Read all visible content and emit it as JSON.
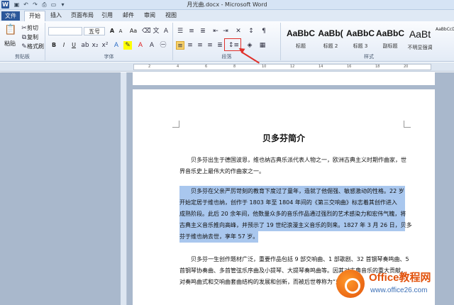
{
  "window": {
    "title": "月光曲.docx - Microsoft Word",
    "app_icon": "W"
  },
  "tabs": [
    {
      "label": "文件"
    },
    {
      "label": "开始"
    },
    {
      "label": "插入"
    },
    {
      "label": "页面布局"
    },
    {
      "label": "引用"
    },
    {
      "label": "邮件"
    },
    {
      "label": "审阅"
    },
    {
      "label": "视图"
    }
  ],
  "ribbon": {
    "clipboard": {
      "group_label": "剪贴板",
      "paste": "粘贴",
      "cut": "剪切",
      "copy": "复制",
      "format_painter": "格式刷"
    },
    "font": {
      "group_label": "字体",
      "font_name": "",
      "font_size": "五号",
      "grow": "A",
      "shrink": "A",
      "clear": "Aa",
      "bold": "B",
      "italic": "I",
      "underline": "U"
    },
    "paragraph": {
      "group_label": "段落"
    },
    "styles": {
      "group_label": "样式",
      "items": [
        {
          "sample": "AaBbC",
          "name": "标题"
        },
        {
          "sample": "AaBb(",
          "name": "标题 2"
        },
        {
          "sample": "AaBbC",
          "name": "标题 3"
        },
        {
          "sample": "AaBbC",
          "name": "副标题"
        },
        {
          "sample": "AaBt",
          "name": "不明显强调"
        }
      ],
      "extra": "AaBbCcD"
    }
  },
  "document": {
    "title": "贝多芬简介",
    "paragraph1": [
      "贝多芬出生于德国波恩，维也纳古典乐派代表人物之一，欧洲古典主义时期作曲家，世",
      "界音乐史上最伟大的作曲家之一。"
    ],
    "paragraph2": [
      "贝多芬在父亲严厉苛刻的教育下度过了童年，造就了他倔强、敏感激动的性格。22 岁",
      "开始定居于维也纳，创作于 1803 年至 1804 年间的《第三交响曲》标志着其创作进入",
      "成熟阶段。此后 20 余年间，他数量众多的音乐作品通过强烈的艺术感染力和宏伟气魄，将",
      "古典主义音乐推向高峰，并预示了 19 世纪浪漫主义音乐的到来。1827 年 3 月 26 日，贝多",
      "芬于维也纳去世，享年 57 岁。"
    ],
    "paragraph3": [
      "贝多芬一生创作题材广泛，重要作品包括 9 部交响曲、1 部歌剧、32 首钢琴奏鸣曲、5",
      "首钢琴协奏曲、多首管弦乐序曲及小提琴、大提琴奏鸣曲等。因其对古典音乐的重大贡献，",
      "对奏鸣曲式和交响曲套曲结构的发展和创新，而被后世尊称为“乐圣”。"
    ]
  },
  "watermark": {
    "line1": "Office教程网",
    "line2": "www.office26.com"
  }
}
